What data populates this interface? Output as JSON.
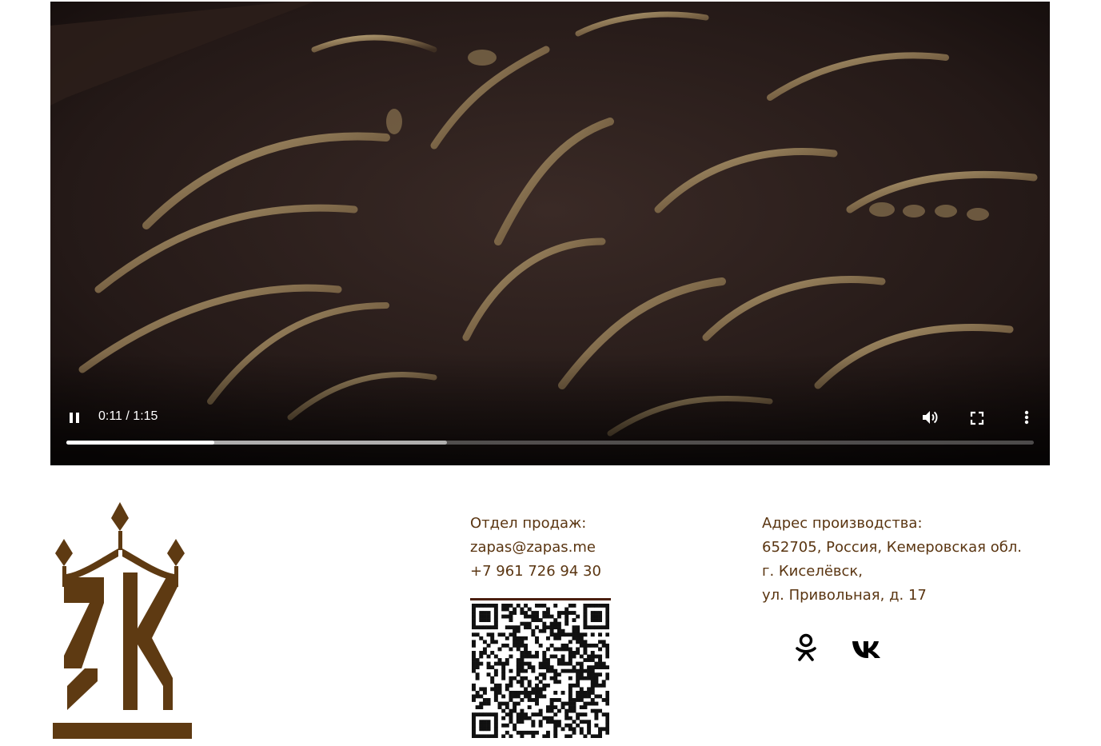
{
  "video": {
    "time_display": "0:11 / 1:15",
    "progress_fraction": 0.153,
    "buffered_fraction": 0.393,
    "controls": {
      "play_pause_icon": "pause-icon",
      "volume_icon": "volume-icon",
      "fullscreen_icon": "fullscreen-icon",
      "more_icon": "more-vertical-icon"
    }
  },
  "footer": {
    "logo": "company-logo",
    "sales": {
      "heading": "Отдел продаж:",
      "email": "zapas@zapas.me",
      "phone": "+7 961 726 94 30"
    },
    "qr_icon": "qr-code-icon",
    "address": {
      "heading": "Адрес производства:",
      "line1": "652705, Россия, Кемеровская обл.",
      "line2": "г. Киселёвск,",
      "line3": "ул. Привольная, д. 17"
    },
    "social": {
      "ok_icon": "odnoklassniki-icon",
      "vk_icon": "vk-icon"
    }
  },
  "colors": {
    "brand_brown": "#5a3511",
    "video_bg": "#1e1414",
    "qr_bar": "#4a1f10"
  }
}
